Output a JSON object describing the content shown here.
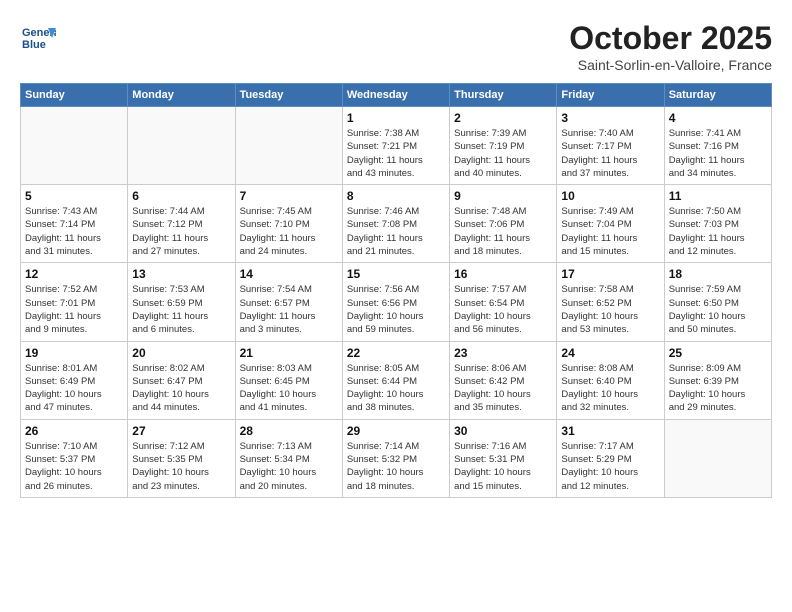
{
  "header": {
    "logo_line1": "General",
    "logo_line2": "Blue",
    "month_year": "October 2025",
    "location": "Saint-Sorlin-en-Valloire, France"
  },
  "weekdays": [
    "Sunday",
    "Monday",
    "Tuesday",
    "Wednesday",
    "Thursday",
    "Friday",
    "Saturday"
  ],
  "weeks": [
    [
      {
        "day": "",
        "info": ""
      },
      {
        "day": "",
        "info": ""
      },
      {
        "day": "",
        "info": ""
      },
      {
        "day": "1",
        "info": "Sunrise: 7:38 AM\nSunset: 7:21 PM\nDaylight: 11 hours\nand 43 minutes."
      },
      {
        "day": "2",
        "info": "Sunrise: 7:39 AM\nSunset: 7:19 PM\nDaylight: 11 hours\nand 40 minutes."
      },
      {
        "day": "3",
        "info": "Sunrise: 7:40 AM\nSunset: 7:17 PM\nDaylight: 11 hours\nand 37 minutes."
      },
      {
        "day": "4",
        "info": "Sunrise: 7:41 AM\nSunset: 7:16 PM\nDaylight: 11 hours\nand 34 minutes."
      }
    ],
    [
      {
        "day": "5",
        "info": "Sunrise: 7:43 AM\nSunset: 7:14 PM\nDaylight: 11 hours\nand 31 minutes."
      },
      {
        "day": "6",
        "info": "Sunrise: 7:44 AM\nSunset: 7:12 PM\nDaylight: 11 hours\nand 27 minutes."
      },
      {
        "day": "7",
        "info": "Sunrise: 7:45 AM\nSunset: 7:10 PM\nDaylight: 11 hours\nand 24 minutes."
      },
      {
        "day": "8",
        "info": "Sunrise: 7:46 AM\nSunset: 7:08 PM\nDaylight: 11 hours\nand 21 minutes."
      },
      {
        "day": "9",
        "info": "Sunrise: 7:48 AM\nSunset: 7:06 PM\nDaylight: 11 hours\nand 18 minutes."
      },
      {
        "day": "10",
        "info": "Sunrise: 7:49 AM\nSunset: 7:04 PM\nDaylight: 11 hours\nand 15 minutes."
      },
      {
        "day": "11",
        "info": "Sunrise: 7:50 AM\nSunset: 7:03 PM\nDaylight: 11 hours\nand 12 minutes."
      }
    ],
    [
      {
        "day": "12",
        "info": "Sunrise: 7:52 AM\nSunset: 7:01 PM\nDaylight: 11 hours\nand 9 minutes."
      },
      {
        "day": "13",
        "info": "Sunrise: 7:53 AM\nSunset: 6:59 PM\nDaylight: 11 hours\nand 6 minutes."
      },
      {
        "day": "14",
        "info": "Sunrise: 7:54 AM\nSunset: 6:57 PM\nDaylight: 11 hours\nand 3 minutes."
      },
      {
        "day": "15",
        "info": "Sunrise: 7:56 AM\nSunset: 6:56 PM\nDaylight: 10 hours\nand 59 minutes."
      },
      {
        "day": "16",
        "info": "Sunrise: 7:57 AM\nSunset: 6:54 PM\nDaylight: 10 hours\nand 56 minutes."
      },
      {
        "day": "17",
        "info": "Sunrise: 7:58 AM\nSunset: 6:52 PM\nDaylight: 10 hours\nand 53 minutes."
      },
      {
        "day": "18",
        "info": "Sunrise: 7:59 AM\nSunset: 6:50 PM\nDaylight: 10 hours\nand 50 minutes."
      }
    ],
    [
      {
        "day": "19",
        "info": "Sunrise: 8:01 AM\nSunset: 6:49 PM\nDaylight: 10 hours\nand 47 minutes."
      },
      {
        "day": "20",
        "info": "Sunrise: 8:02 AM\nSunset: 6:47 PM\nDaylight: 10 hours\nand 44 minutes."
      },
      {
        "day": "21",
        "info": "Sunrise: 8:03 AM\nSunset: 6:45 PM\nDaylight: 10 hours\nand 41 minutes."
      },
      {
        "day": "22",
        "info": "Sunrise: 8:05 AM\nSunset: 6:44 PM\nDaylight: 10 hours\nand 38 minutes."
      },
      {
        "day": "23",
        "info": "Sunrise: 8:06 AM\nSunset: 6:42 PM\nDaylight: 10 hours\nand 35 minutes."
      },
      {
        "day": "24",
        "info": "Sunrise: 8:08 AM\nSunset: 6:40 PM\nDaylight: 10 hours\nand 32 minutes."
      },
      {
        "day": "25",
        "info": "Sunrise: 8:09 AM\nSunset: 6:39 PM\nDaylight: 10 hours\nand 29 minutes."
      }
    ],
    [
      {
        "day": "26",
        "info": "Sunrise: 7:10 AM\nSunset: 5:37 PM\nDaylight: 10 hours\nand 26 minutes."
      },
      {
        "day": "27",
        "info": "Sunrise: 7:12 AM\nSunset: 5:35 PM\nDaylight: 10 hours\nand 23 minutes."
      },
      {
        "day": "28",
        "info": "Sunrise: 7:13 AM\nSunset: 5:34 PM\nDaylight: 10 hours\nand 20 minutes."
      },
      {
        "day": "29",
        "info": "Sunrise: 7:14 AM\nSunset: 5:32 PM\nDaylight: 10 hours\nand 18 minutes."
      },
      {
        "day": "30",
        "info": "Sunrise: 7:16 AM\nSunset: 5:31 PM\nDaylight: 10 hours\nand 15 minutes."
      },
      {
        "day": "31",
        "info": "Sunrise: 7:17 AM\nSunset: 5:29 PM\nDaylight: 10 hours\nand 12 minutes."
      },
      {
        "day": "",
        "info": ""
      }
    ]
  ]
}
